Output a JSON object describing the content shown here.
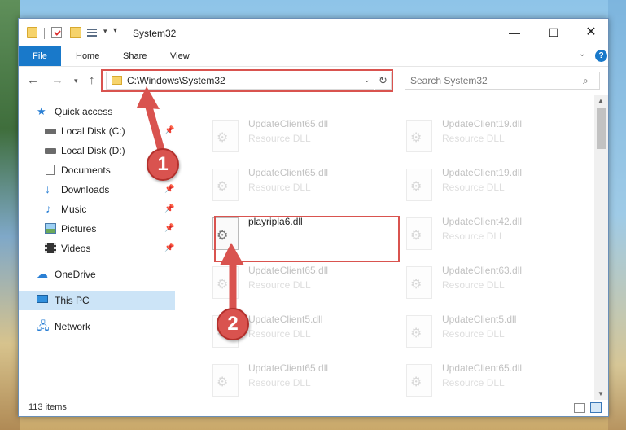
{
  "window": {
    "title": "System32",
    "min_symbol": "—",
    "max_symbol": "☐",
    "close_symbol": "✕"
  },
  "ribbon": {
    "file": "File",
    "home": "Home",
    "share": "Share",
    "view": "View",
    "help": "?"
  },
  "address": {
    "path": "C:\\Windows\\System32",
    "refresh": "↻"
  },
  "search": {
    "placeholder": "Search System32",
    "icon": "⌕"
  },
  "sidebar": {
    "items": [
      {
        "label": "Quick access",
        "icon": "star-icon",
        "pinned": false
      },
      {
        "label": "Local Disk (C:)",
        "icon": "disk-icon",
        "pinned": true
      },
      {
        "label": "Local Disk (D:)",
        "icon": "disk-icon",
        "pinned": false
      },
      {
        "label": "Documents",
        "icon": "documents-icon",
        "pinned": true
      },
      {
        "label": "Downloads",
        "icon": "download-icon",
        "pinned": true
      },
      {
        "label": "Music",
        "icon": "music-icon",
        "pinned": true
      },
      {
        "label": "Pictures",
        "icon": "pictures-icon",
        "pinned": true
      },
      {
        "label": "Videos",
        "icon": "videos-icon",
        "pinned": true
      },
      {
        "label": "OneDrive",
        "icon": "cloud-icon",
        "pinned": false
      },
      {
        "label": "This PC",
        "icon": "computer-icon",
        "pinned": false
      },
      {
        "label": "Network",
        "icon": "network-icon",
        "pinned": false
      }
    ],
    "selected": "This PC"
  },
  "files": {
    "col1": [
      {
        "name": "UpdateClient65.dll",
        "type": "Resource DLL"
      },
      {
        "name": "UpdateClient65.dll",
        "type": "Resource DLL"
      },
      {
        "name": "playripla6.dll",
        "type": ""
      },
      {
        "name": "UpdateClient65.dll",
        "type": "Resource DLL"
      },
      {
        "name": "UpdateClient5.dll",
        "type": "Resource DLL"
      },
      {
        "name": "UpdateClient65.dll",
        "type": "Resource DLL"
      }
    ],
    "col2": [
      {
        "name": "UpdateClient19.dll",
        "type": "Resource DLL"
      },
      {
        "name": "UpdateClient19.dll",
        "type": "Resource DLL"
      },
      {
        "name": "UpdateClient42.dll",
        "type": "Resource DLL"
      },
      {
        "name": "UpdateClient63.dll",
        "type": "Resource DLL"
      },
      {
        "name": "UpdateClient5.dll",
        "type": "Resource DLL"
      },
      {
        "name": "UpdateClient65.dll",
        "type": "Resource DLL"
      }
    ]
  },
  "status": {
    "item_count": "113 items"
  },
  "annotations": {
    "step1": "1",
    "step2": "2",
    "color": "#d9534f"
  }
}
